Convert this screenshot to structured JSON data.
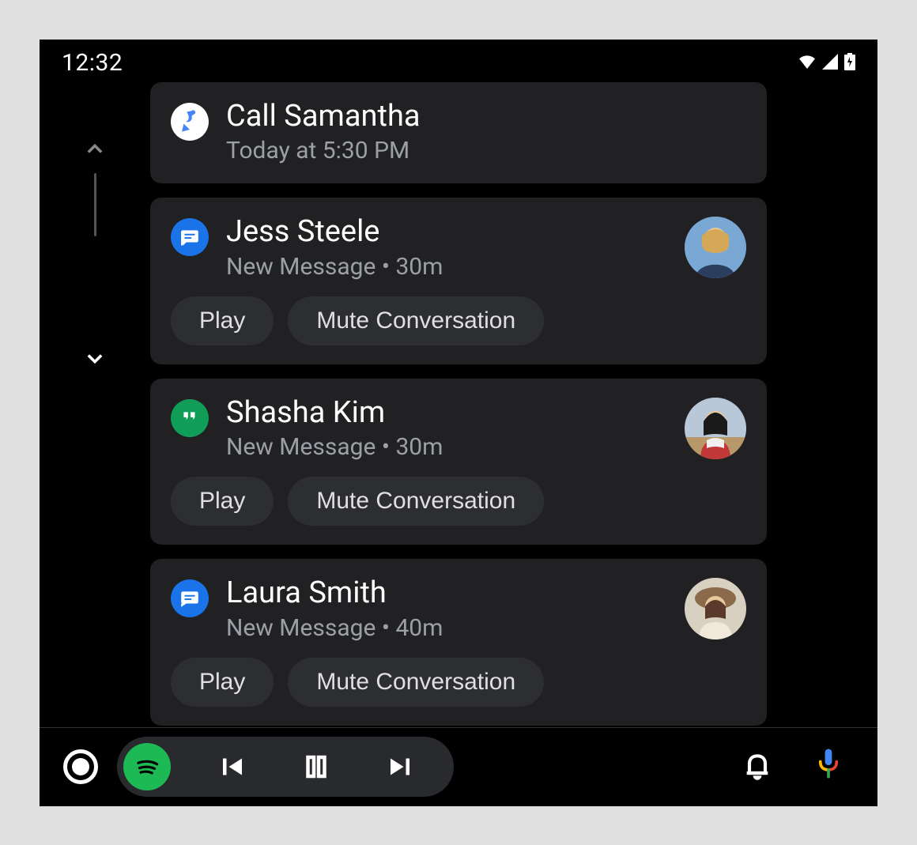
{
  "status": {
    "time": "12:32"
  },
  "cards": [
    {
      "icon": "reminder",
      "title": "Call Samantha",
      "subtitle": "Today at 5:30 PM",
      "has_avatar": false,
      "actions": []
    },
    {
      "icon": "messages",
      "title": "Jess Steele",
      "subtitle": "New Message • 30m",
      "has_avatar": true,
      "actions": [
        "Play",
        "Mute Conversation"
      ]
    },
    {
      "icon": "hangouts",
      "title": "Shasha Kim",
      "subtitle": "New Message • 30m",
      "has_avatar": true,
      "actions": [
        "Play",
        "Mute Conversation"
      ]
    },
    {
      "icon": "messages",
      "title": "Laura Smith",
      "subtitle": "New Message • 40m",
      "has_avatar": true,
      "actions": [
        "Play",
        "Mute Conversation"
      ]
    }
  ],
  "buttons": {
    "play": "Play",
    "mute": "Mute Conversation"
  },
  "colors": {
    "card_bg": "#212124",
    "pill_bg": "#2d2e31",
    "subtitle": "#9aa0a6",
    "blue": "#1a73e8",
    "green_hangouts": "#0f9d58",
    "spotify": "#1db954"
  }
}
